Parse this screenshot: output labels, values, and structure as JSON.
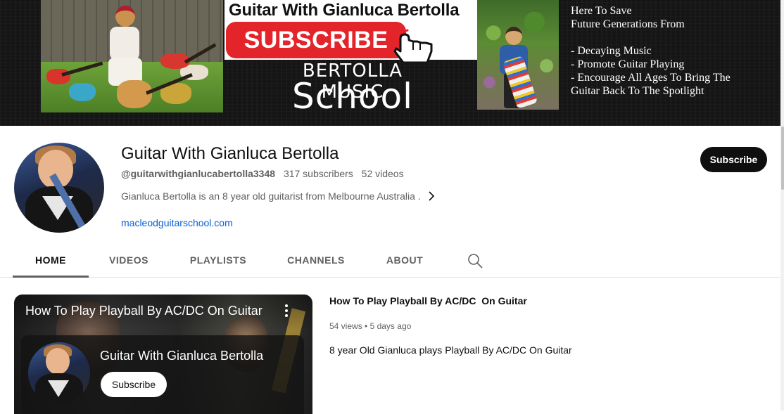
{
  "banner": {
    "sub_title": "Guitar With Gianluca Bertolla",
    "subscribe_graphic": "SUBSCRIBE",
    "school_top": "BERTOLLA MUSIC",
    "school_bottom": "School",
    "lines": [
      "Here To Save",
      "Future Generations From",
      "- Decaying Music",
      "- Promote Guitar Playing",
      "- Encourage All Ages To Bring The",
      "Guitar Back To The Spotlight"
    ]
  },
  "channel": {
    "title": "Guitar With Gianluca Bertolla",
    "handle": "@guitarwithgianlucabertolla3348",
    "subscribers": "317 subscribers",
    "videos": "52 videos",
    "description": "Gianluca Bertolla is an 8 year old guitarist from Melbourne Australia .",
    "link": "macleodguitarschool.com",
    "subscribe_label": "Subscribe"
  },
  "tabs": [
    {
      "label": "HOME",
      "active": true
    },
    {
      "label": "VIDEOS",
      "active": false
    },
    {
      "label": "PLAYLISTS",
      "active": false
    },
    {
      "label": "CHANNELS",
      "active": false
    },
    {
      "label": "ABOUT",
      "active": false
    }
  ],
  "featured": {
    "player_title": "How To Play Playball By AC/DC On Guitar",
    "endcard_channel": "Guitar With Gianluca Bertolla",
    "endcard_subscribe": "Subscribe",
    "title": "How To Play Playball By AC/DC  On Guitar",
    "views": "54 views",
    "age": "5 days ago",
    "description": "8 year Old Gianluca plays Playball By AC/DC On Guitar"
  },
  "icons": {
    "search": "search-icon",
    "chevron": "chevron-right-icon",
    "kebab": "more-vert-icon",
    "hand": "pointer-hand-icon"
  },
  "colors": {
    "subscribe_button": "#0f0f0f",
    "link": "#065fd4",
    "banner_red": "#e3242b"
  }
}
